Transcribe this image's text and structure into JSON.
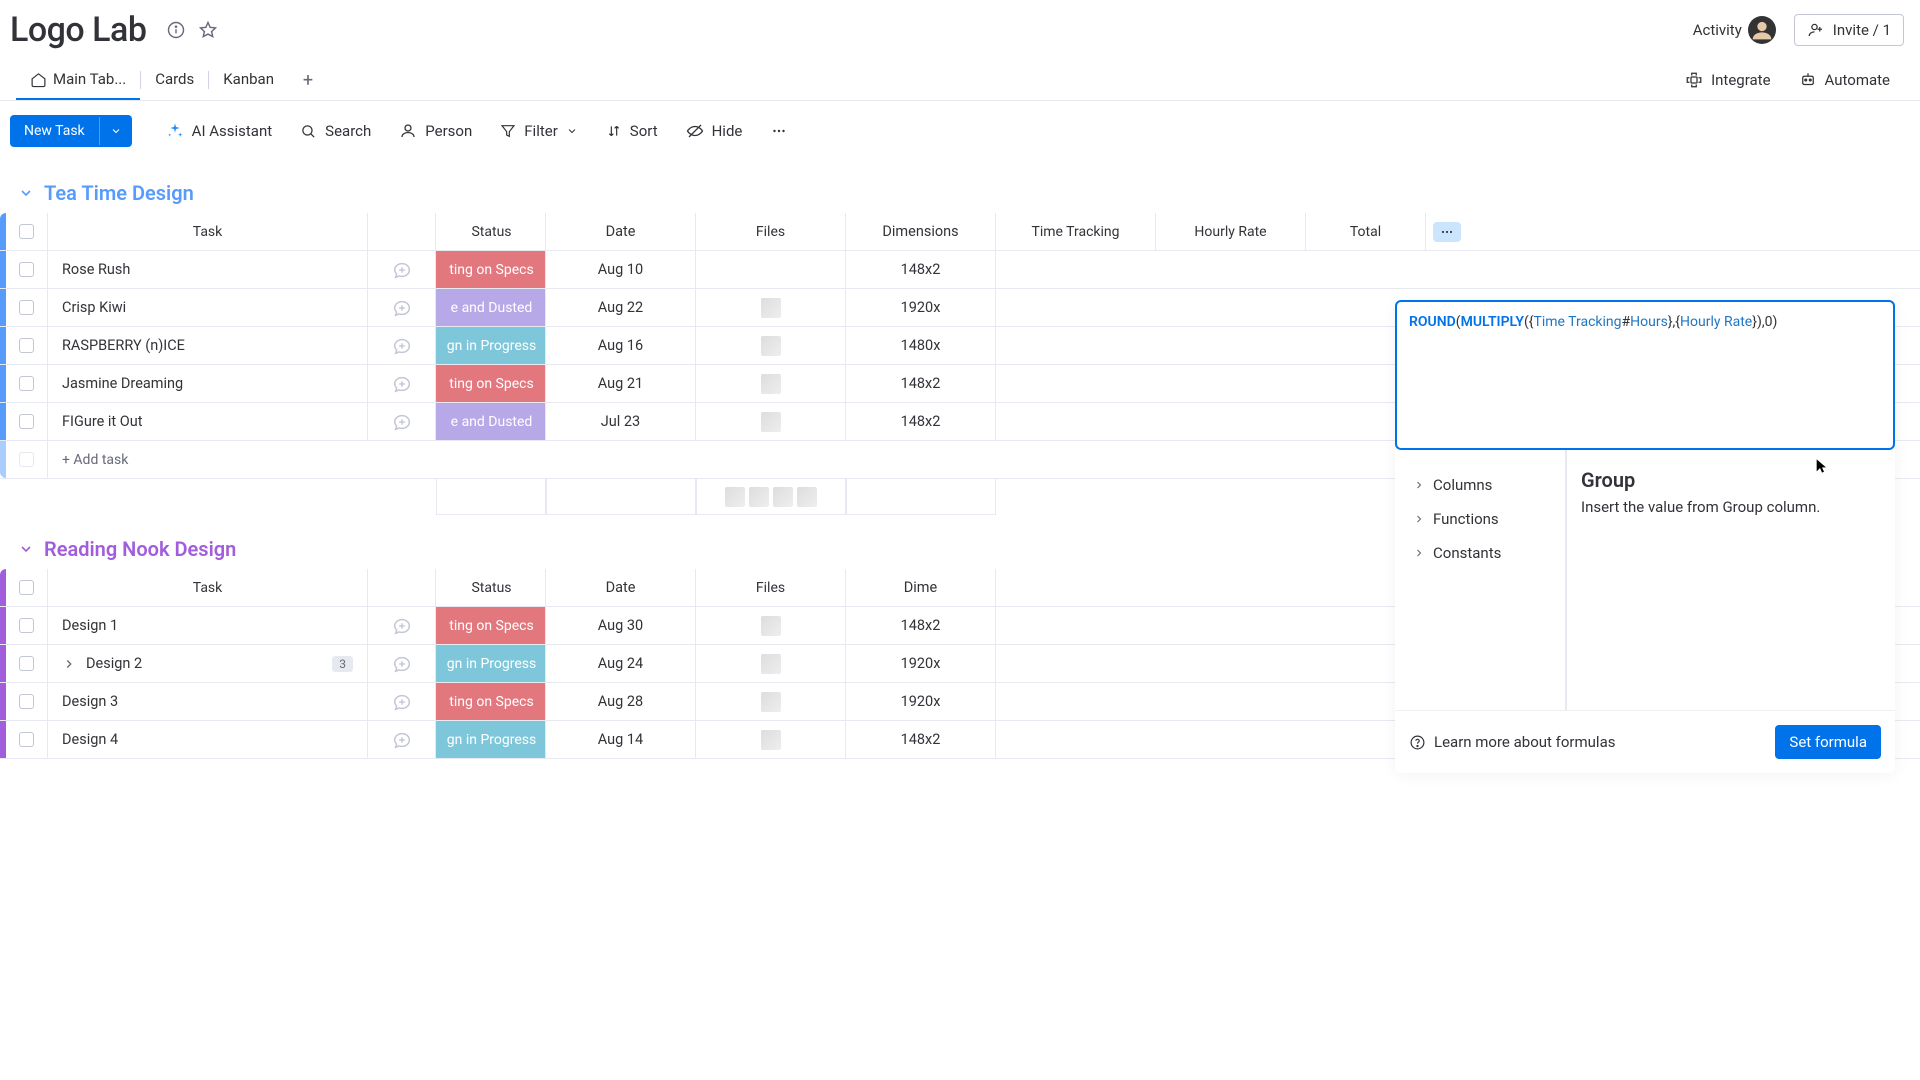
{
  "header": {
    "title": "Logo Lab",
    "activity_label": "Activity",
    "invite_label": "Invite / 1"
  },
  "tabs": {
    "items": [
      "Main Tab...",
      "Cards",
      "Kanban"
    ],
    "active": 0,
    "integrate": "Integrate",
    "automate": "Automate"
  },
  "toolbar": {
    "new_task": "New Task",
    "ai": "AI Assistant",
    "search": "Search",
    "person": "Person",
    "filter": "Filter",
    "sort": "Sort",
    "hide": "Hide"
  },
  "columns": {
    "task": "Task",
    "status": "Status",
    "date": "Date",
    "files": "Files",
    "dimensions": "Dimensions",
    "time": "Time Tracking",
    "rate": "Hourly Rate",
    "total": "Total"
  },
  "add_task": "+ Add task",
  "groups": [
    {
      "name": "Tea Time Design",
      "color": "#579bfc",
      "rows": [
        {
          "task": "Rose Rush",
          "status": "ting on Specs",
          "status_class": "status-red",
          "date": "Aug 10",
          "file": false,
          "dim": "148x2"
        },
        {
          "task": "Crisp Kiwi",
          "status": "e and Dusted",
          "status_class": "status-lav",
          "date": "Aug 22",
          "file": true,
          "dim": "1920x"
        },
        {
          "task": "RASPBERRY (n)ICE",
          "status": "gn in Progress",
          "status_class": "status-sky",
          "date": "Aug 16",
          "file": true,
          "dim": "1480x"
        },
        {
          "task": "Jasmine Dreaming",
          "status": "ting on Specs",
          "status_class": "status-red",
          "date": "Aug 21",
          "file": true,
          "dim": "148x2"
        },
        {
          "task": "FIGure it Out",
          "status": "e and Dusted",
          "status_class": "status-lav",
          "date": "Jul 23",
          "file": true,
          "dim": "148x2"
        }
      ]
    },
    {
      "name": "Reading Nook Design",
      "color": "#a25ddc",
      "rows": [
        {
          "task": "Design 1",
          "status": "ting on Specs",
          "status_class": "status-red",
          "date": "Aug 30",
          "file": true,
          "dim": "148x2"
        },
        {
          "task": "Design 2",
          "subitems": 3,
          "status": "gn in Progress",
          "status_class": "status-sky",
          "date": "Aug 24",
          "file": true,
          "dim": "1920x"
        },
        {
          "task": "Design 3",
          "status": "ting on Specs",
          "status_class": "status-red",
          "date": "Aug 28",
          "file": true,
          "dim": "1920x"
        },
        {
          "task": "Design 4",
          "status": "gn in Progress",
          "status_class": "status-sky",
          "date": "Aug 14",
          "file": true,
          "dim": "148x2"
        }
      ]
    }
  ],
  "formula": {
    "tokens": [
      {
        "t": "ROUND",
        "c": "tok-fn"
      },
      {
        "t": "(",
        "c": "tok-p"
      },
      {
        "t": "MULTIPLY",
        "c": "tok-fn"
      },
      {
        "t": "({",
        "c": "tok-p"
      },
      {
        "t": "Time Tracking",
        "c": "tok-col"
      },
      {
        "t": "#",
        "c": "tok-p"
      },
      {
        "t": "Hours",
        "c": "tok-ref"
      },
      {
        "t": "},{",
        "c": "tok-p"
      },
      {
        "t": "Hourly Rate",
        "c": "tok-col"
      },
      {
        "t": "}),",
        "c": "tok-p"
      },
      {
        "t": "0",
        "c": "tok-num"
      },
      {
        "t": ")",
        "c": "tok-p"
      }
    ],
    "sections": {
      "columns": "Columns",
      "functions": "Functions",
      "constants": "Constants"
    },
    "hint_title": "Group",
    "hint_desc": "Insert the value from Group column.",
    "learn_more": "Learn more about formulas",
    "set_btn": "Set formula"
  }
}
